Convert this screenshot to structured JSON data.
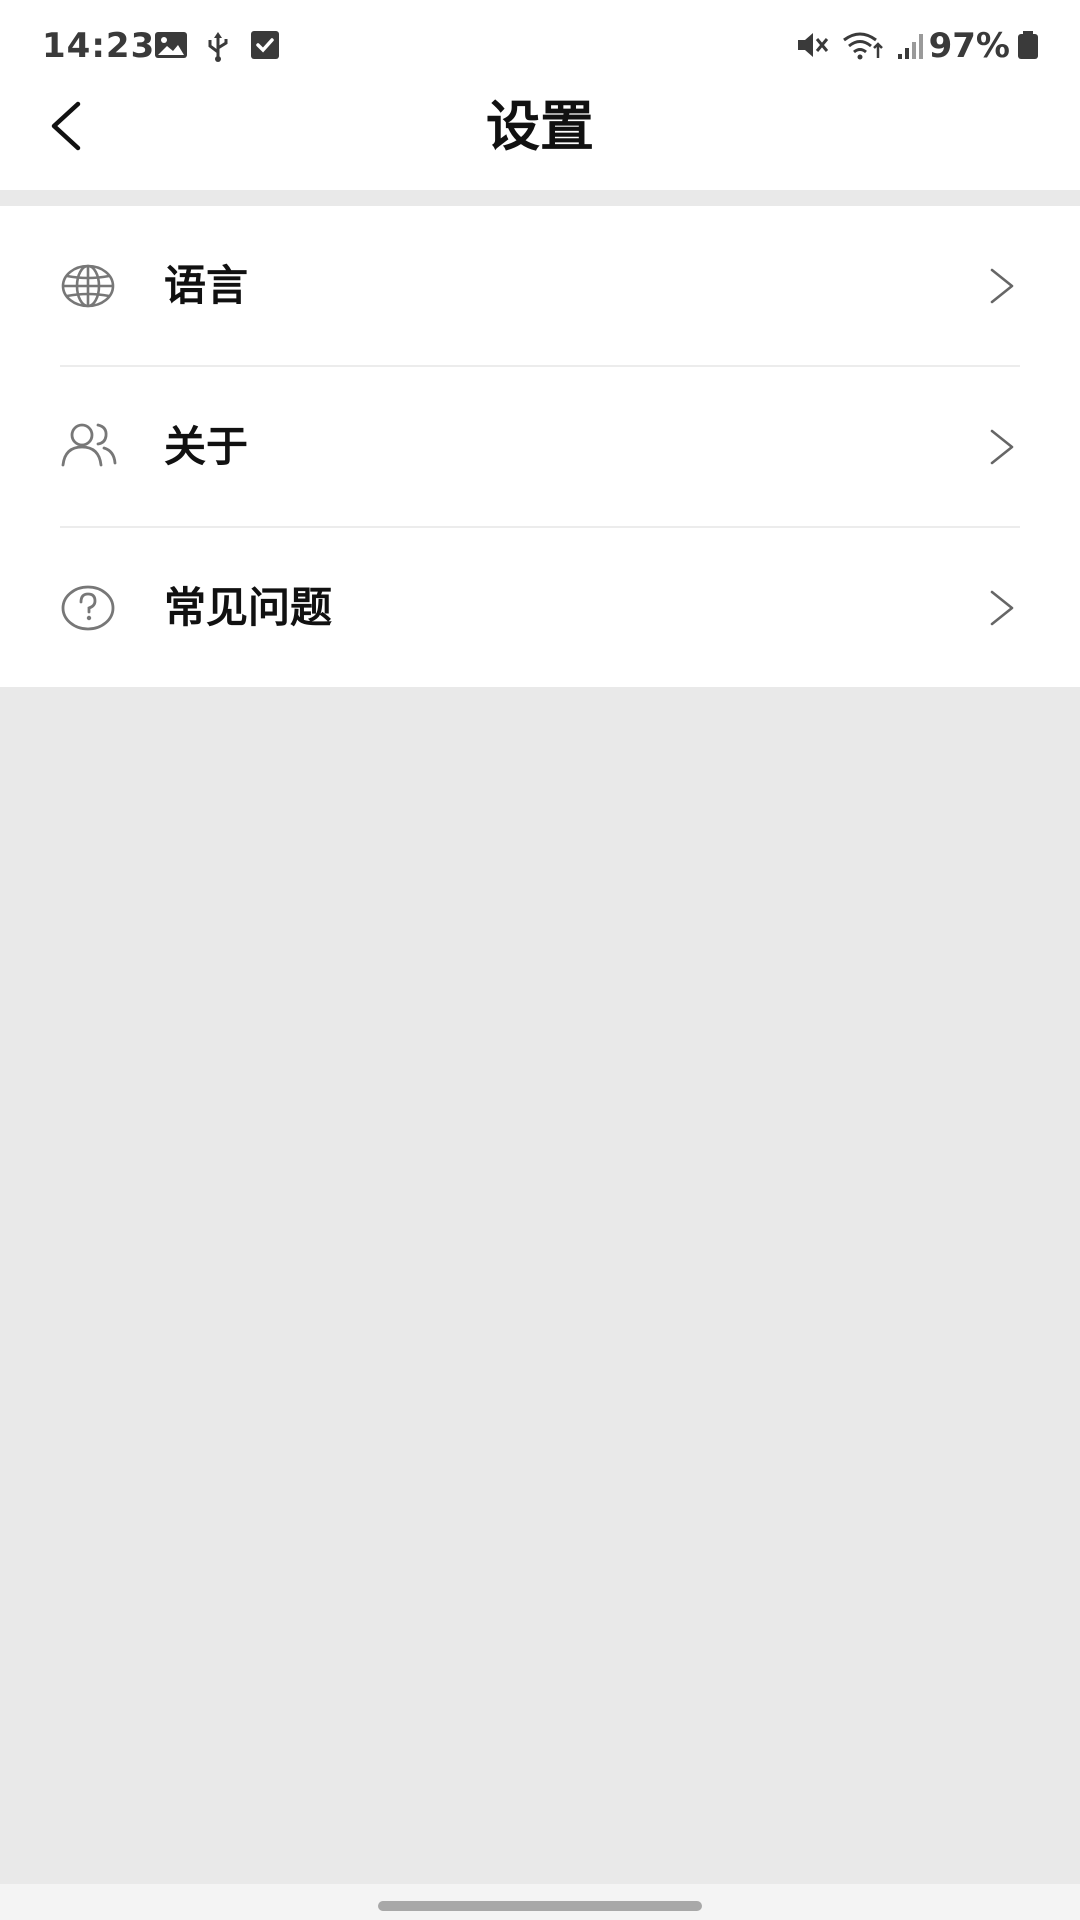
{
  "status_bar": {
    "time": "14:23",
    "battery": "97%",
    "icons": [
      "image-icon",
      "usb-icon",
      "check-box-icon",
      "mute-icon",
      "wifi-icon",
      "signal-icon",
      "battery-icon"
    ]
  },
  "header": {
    "title": "设置",
    "back_icon": "chevron-left-icon"
  },
  "settings": {
    "items": [
      {
        "label": "语言",
        "icon": "globe-icon"
      },
      {
        "label": "关于",
        "icon": "users-icon"
      },
      {
        "label": "常见问题",
        "icon": "question-icon"
      }
    ]
  },
  "colors": {
    "page_background": "#e9e9e9",
    "surface": "#ffffff",
    "icon_gray": "#777777",
    "divider": "#ececec"
  }
}
